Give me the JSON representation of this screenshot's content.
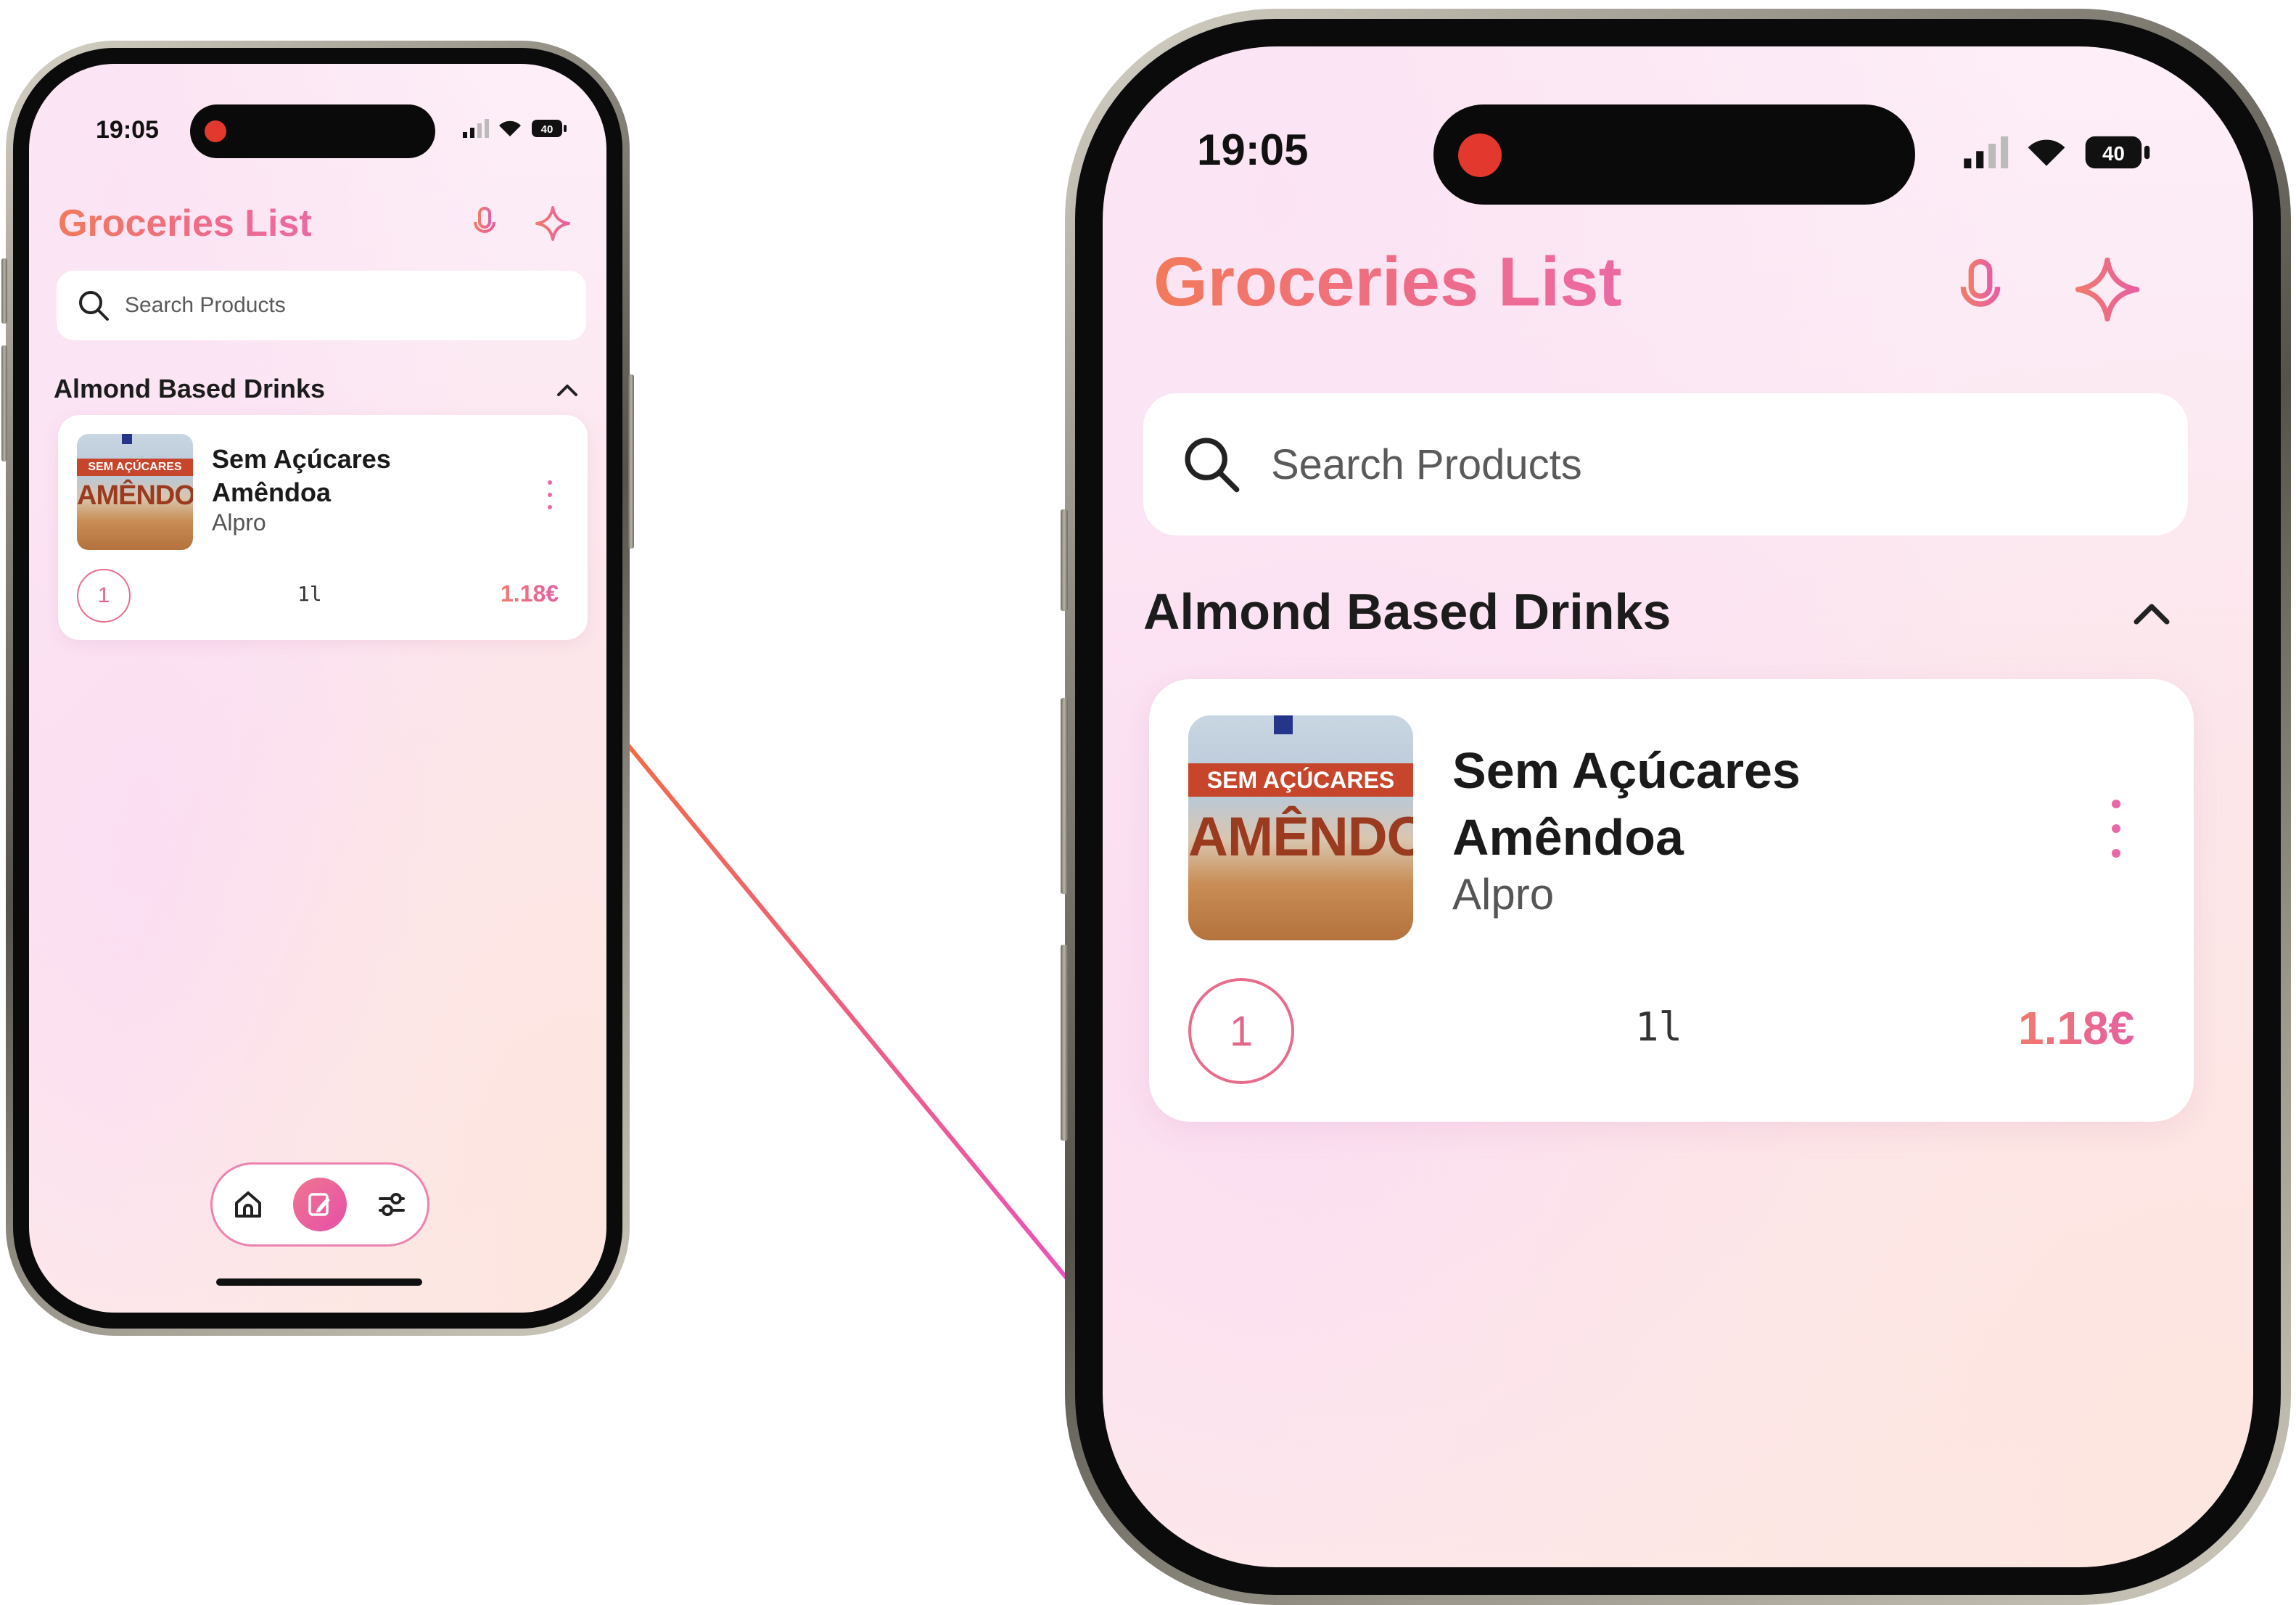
{
  "colors": {
    "accent_orange": "#f27a5a",
    "accent_pink": "#ec6aa3",
    "connector": "#ee5c8e",
    "background": "#ffffff"
  },
  "status_bar": {
    "time": "19:05",
    "battery": "40"
  },
  "header": {
    "title": "Groceries List",
    "mic_icon": "microphone-icon",
    "ai_icon": "sparkle-icon"
  },
  "search": {
    "placeholder": "Search Products",
    "icon": "search-icon"
  },
  "section": {
    "label": "Almond Based Drinks",
    "toggle_icon": "chevron-up-icon"
  },
  "product": {
    "name_line1": "Sem Açúcares",
    "name_line2": "Amêndoa",
    "brand": "Alpro",
    "image_band": "SEM AÇÚCARES",
    "image_big": "AMÊNDOA",
    "quantity": "1",
    "unit": "1l",
    "price": "1.18€"
  },
  "bottom_nav": {
    "items": [
      {
        "name": "home",
        "icon": "home-icon",
        "active": false
      },
      {
        "name": "list",
        "icon": "edit-list-icon",
        "active": true
      },
      {
        "name": "settings",
        "icon": "sliders-icon",
        "active": false
      }
    ]
  }
}
